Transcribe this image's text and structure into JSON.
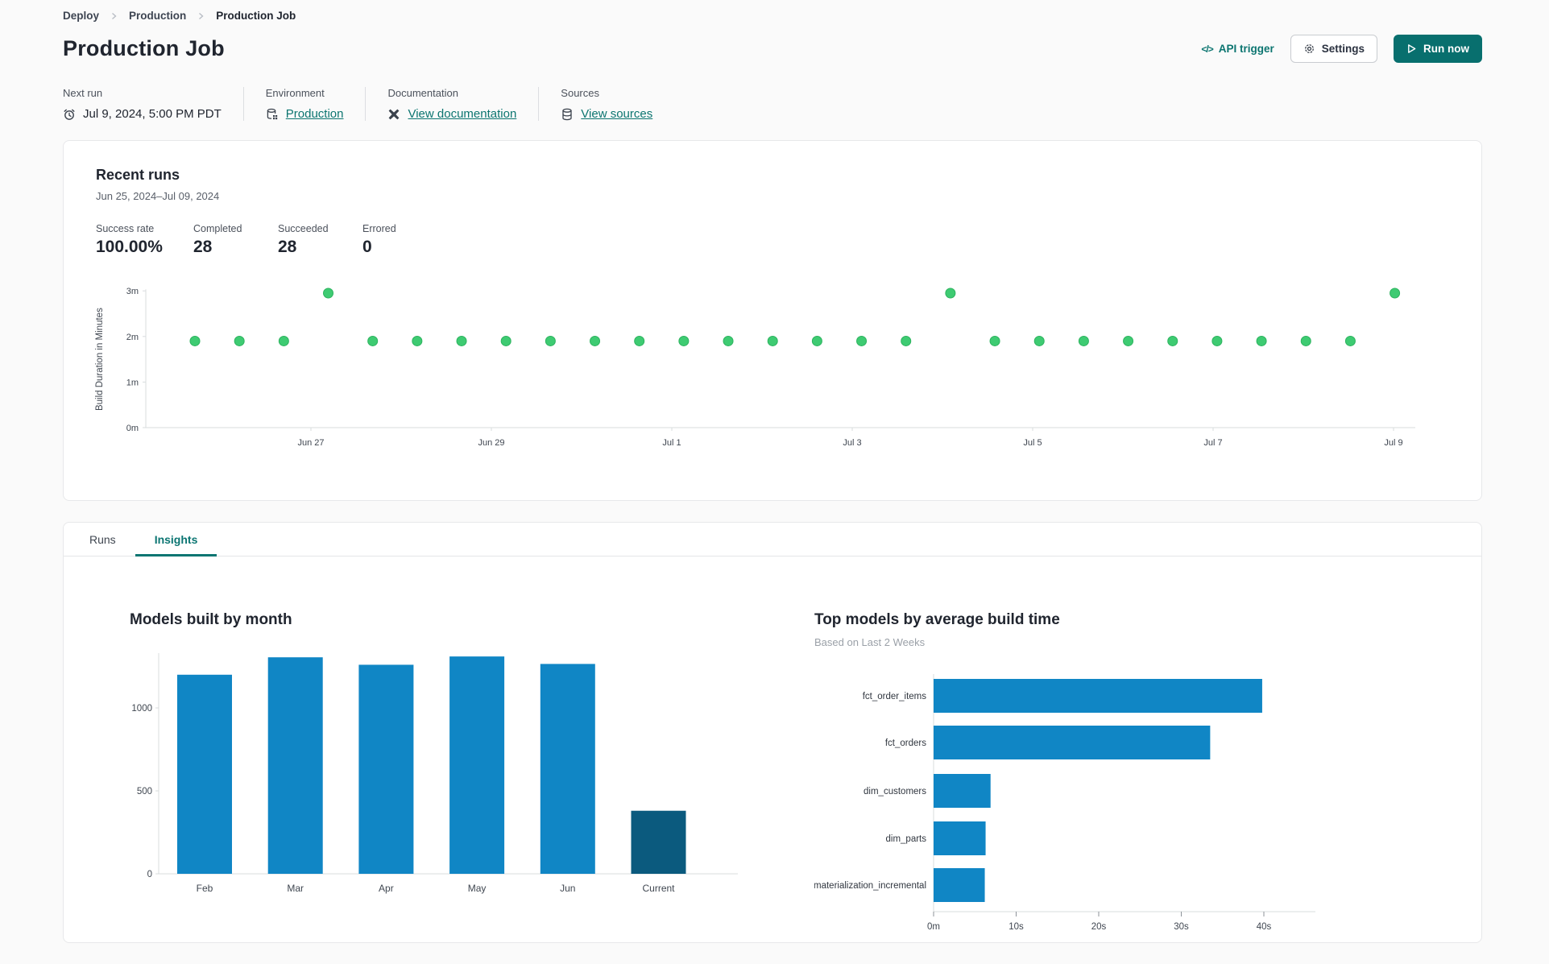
{
  "breadcrumb": {
    "items": [
      {
        "label": "Deploy"
      },
      {
        "label": "Production"
      },
      {
        "label": "Production Job"
      }
    ]
  },
  "header": {
    "title": "Production Job",
    "api_trigger_label": "API trigger",
    "api_trigger_glyph": "</>",
    "settings_label": "Settings",
    "run_now_label": "Run now"
  },
  "meta": {
    "next_run": {
      "label": "Next run",
      "value": "Jul 9, 2024, 5:00 PM PDT"
    },
    "environment": {
      "label": "Environment",
      "link": "Production"
    },
    "documentation": {
      "label": "Documentation",
      "link": "View documentation"
    },
    "sources": {
      "label": "Sources",
      "link": "View sources"
    }
  },
  "recent_runs": {
    "title": "Recent runs",
    "date_range": "Jun 25, 2024–Jul 09, 2024",
    "stats": [
      {
        "label": "Success rate",
        "value": "100.00%"
      },
      {
        "label": "Completed",
        "value": "28"
      },
      {
        "label": "Succeeded",
        "value": "28"
      },
      {
        "label": "Errored",
        "value": "0"
      }
    ],
    "chart_data": {
      "type": "scatter",
      "ylabel": "Build Duration in Minutes",
      "y_ticks": [
        "0m",
        "1m",
        "2m",
        "3m"
      ],
      "x_ticks": [
        "Jun 27",
        "Jun 29",
        "Jul 1",
        "Jul 3",
        "Jul 5",
        "Jul 7",
        "Jul 9"
      ],
      "ylim": [
        0,
        3
      ],
      "point_color": "#3ecb72",
      "point_edge_color": "#2db35f",
      "durations_minutes": [
        1.9,
        1.9,
        1.9,
        2.95,
        1.9,
        1.9,
        1.9,
        1.9,
        1.9,
        1.9,
        1.9,
        1.9,
        1.9,
        1.9,
        1.9,
        1.9,
        1.9,
        2.95,
        1.9,
        1.9,
        1.9,
        1.9,
        1.9,
        1.9,
        1.9,
        1.9,
        1.9,
        2.95
      ]
    }
  },
  "tabs": {
    "items": [
      {
        "label": "Runs",
        "active": false
      },
      {
        "label": "Insights",
        "active": true
      }
    ]
  },
  "insights": {
    "models_by_month": {
      "title": "Models built by month",
      "chart_data": {
        "type": "bar",
        "categories": [
          "Feb",
          "Mar",
          "Apr",
          "May",
          "Jun",
          "Current"
        ],
        "values": [
          1200,
          1305,
          1260,
          1310,
          1265,
          380
        ],
        "y_ticks": [
          0,
          500,
          1000
        ],
        "ylim": [
          0,
          1350
        ],
        "bar_color": "#1086c5",
        "highlight_category": "Current",
        "highlight_color": "#0b5a7e"
      }
    },
    "top_models": {
      "title": "Top models by average build time",
      "subtitle": "Based on Last 2 Weeks",
      "chart_data": {
        "type": "bar",
        "orientation": "horizontal",
        "categories": [
          "fct_order_items",
          "fct_orders",
          "dim_customers",
          "dim_parts",
          "materialization_incremental"
        ],
        "values_seconds": [
          39.8,
          33.5,
          6.9,
          6.3,
          6.2
        ],
        "x_ticks": [
          "0m",
          "10s",
          "20s",
          "30s",
          "40s"
        ],
        "xlim_seconds": [
          0,
          46
        ],
        "bar_color": "#1086c5"
      }
    }
  },
  "colors": {
    "accent_teal": "#0c7570",
    "run_button": "#086f6e",
    "bar_blue": "#1086c5",
    "bar_dark": "#0b5a7e",
    "dot_green": "#3ecb72"
  }
}
